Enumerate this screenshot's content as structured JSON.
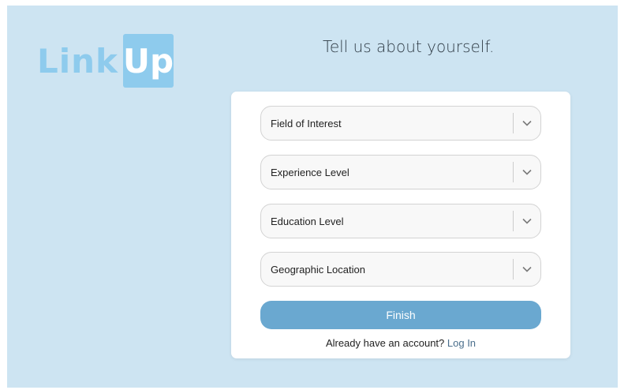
{
  "logo": {
    "part1": "Link",
    "part2": "Up"
  },
  "heading": "Tell us about yourself.",
  "form": {
    "selects": [
      {
        "label": "Field of Interest"
      },
      {
        "label": "Experience Level"
      },
      {
        "label": "Education Level"
      },
      {
        "label": "Geographic Location"
      }
    ],
    "finish_label": "Finish",
    "footer_text": "Already have an account?",
    "login_link": "Log In"
  },
  "icons": {
    "select_arrow": "chevron-down-icon"
  },
  "colors": {
    "page_bg": "#cde4f2",
    "logo": "#8ecbed",
    "button": "#6aa8d0",
    "link": "#4a6f8c"
  }
}
